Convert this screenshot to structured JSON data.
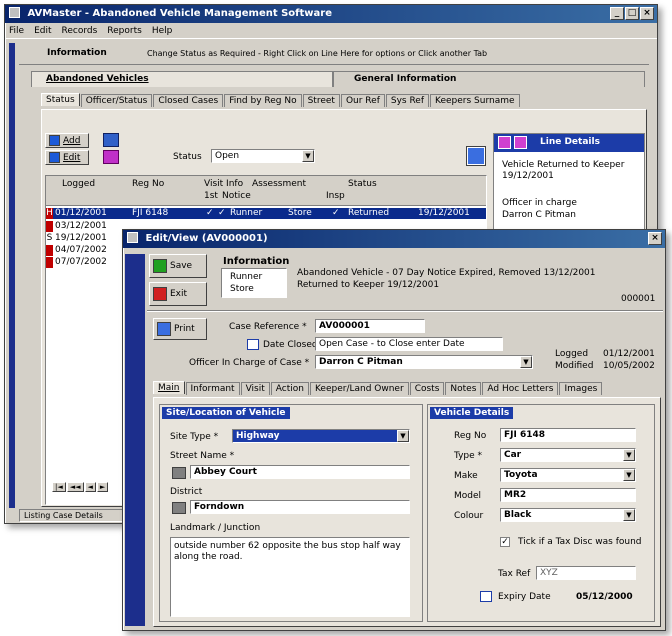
{
  "main_window": {
    "title": "AVMaster - Abandoned Vehicle Management Software",
    "title_buttons": [
      "_",
      "□",
      "×"
    ],
    "menu": [
      "File",
      "Edit",
      "Records",
      "Reports",
      "Help"
    ],
    "info_label": "Information",
    "info_text": "Change Status as Required - Right Click on Line Here for options or Click another Tab",
    "top_tabs": [
      "Abandoned Vehicles",
      "General Information"
    ],
    "sub_tabs": [
      "Status",
      "Officer/Status",
      "Closed Cases",
      "Find by Reg No",
      "Street",
      "Our Ref",
      "Sys Ref",
      "Keepers Surname"
    ],
    "add_label": "Add",
    "edit_label": "Edit",
    "status_label": "Status",
    "status_value": "Open",
    "columns": [
      "Logged",
      "Reg No",
      "Visit Info",
      "Assessment",
      "Status"
    ],
    "sub_columns": [
      "1st",
      "Notice",
      "Insp"
    ],
    "rows": [
      {
        "flag": "H",
        "date": "01/12/2001",
        "reg": "FJI 6148",
        "check1": "✓",
        "check2": "✓",
        "assessment": "Runner",
        "type": "Store",
        "check3": "✓",
        "status": "Returned",
        "status_date": "19/12/2001"
      },
      {
        "flag": "",
        "date": "03/12/2001",
        "reg": "",
        "check1": "",
        "check2": "",
        "assessment": "",
        "type": "",
        "check3": "",
        "status": "",
        "status_date": ""
      },
      {
        "flag": "S",
        "date": "19/12/2001",
        "reg": "",
        "check1": "",
        "check2": "",
        "assessment": "",
        "type": "",
        "check3": "",
        "status": "",
        "status_date": ""
      },
      {
        "flag": "",
        "date": "04/07/2002",
        "reg": "",
        "check1": "",
        "check2": "",
        "assessment": "",
        "type": "",
        "check3": "",
        "status": "",
        "status_date": ""
      },
      {
        "flag": "",
        "date": "07/07/2002",
        "reg": "",
        "check1": "",
        "check2": "",
        "assessment": "",
        "type": "",
        "check3": "",
        "status": "",
        "status_date": ""
      }
    ],
    "line_details_title": "Line Details",
    "line_details_text1": "Vehicle Returned to Keeper 19/12/2001",
    "line_details_text2": "Officer in charge",
    "line_details_text3": "Darron C Pitman",
    "nav_buttons": [
      "|◄",
      "◄◄",
      "◄",
      "►"
    ],
    "status_bar": "Listing Case Details"
  },
  "edit_window": {
    "title": "Edit/View  (AV000001)",
    "save_label": "Save",
    "exit_label": "Exit",
    "info_label": "Information",
    "info_assess1": "Runner",
    "info_assess2": "Store",
    "info_line1": "Abandoned Vehicle - 07 Day Notice Expired, Removed 13/12/2001",
    "info_line2": "Returned to Keeper 19/12/2001",
    "info_id": "000001",
    "print_label": "Print",
    "case_ref_label": "Case Reference *",
    "case_ref_value": "AV000001",
    "date_closed_label": "Date Closed",
    "date_closed_value": "Open Case - to Close enter Date",
    "officer_label": "Officer In Charge of Case *",
    "officer_value": "Darron C Pitman",
    "logged_label": "Logged",
    "logged_value": "01/12/2001",
    "modified_label": "Modified",
    "modified_value": "10/05/2002",
    "tabs": [
      "Main",
      "Informant",
      "Visit",
      "Action",
      "Keeper/Land Owner",
      "Costs",
      "Notes",
      "Ad Hoc Letters",
      "Images"
    ],
    "site_section_title": "Site/Location of Vehicle",
    "site_type_label": "Site Type *",
    "site_type_value": "Highway",
    "street_label": "Street Name *",
    "street_value": "Abbey Court",
    "district_label": "District",
    "district_value": "Forndown",
    "landmark_label": "Landmark / Junction",
    "landmark_value": "outside number 62 opposite the bus stop half way along the road.",
    "vehicle_section_title": "Vehicle Details",
    "reg_label": "Reg No",
    "reg_value": "FJI 6148",
    "type_label": "Type *",
    "type_value": "Car",
    "make_label": "Make",
    "make_value": "Toyota",
    "model_label": "Model",
    "model_value": "MR2",
    "colour_label": "Colour",
    "colour_value": "Black",
    "taxdisc_label": "Tick if a Tax Disc was found",
    "taxref_label": "Tax Ref",
    "taxref_value": "XYZ",
    "expiry_label": "Expiry Date",
    "expiry_value": "05/12/2000"
  },
  "colors": {
    "title_blue": "#08246b",
    "section_navy": "#1c3ca8",
    "selection": "#0a2a8c",
    "flag_red": "#c00000",
    "window_grey": "#d4d0c8"
  }
}
